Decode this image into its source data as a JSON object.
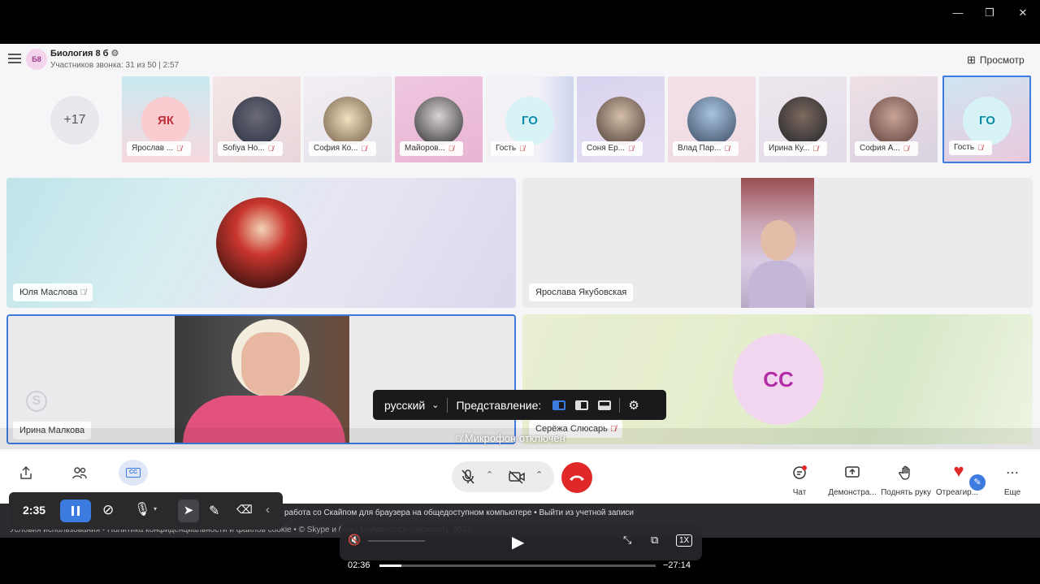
{
  "group": {
    "initials": "Б8",
    "title": "Биология 8 б",
    "subtitle": "Участников звонка: 31 из 50 | 2:57",
    "overflow": "+17",
    "preview_label": "Просмотр"
  },
  "thumbs": [
    {
      "name": "Ярослав ...",
      "initials": "ЯК"
    },
    {
      "name": "Sofiya Ho..."
    },
    {
      "name": "София Ко..."
    },
    {
      "name": "Майоров..."
    },
    {
      "name": "Гость",
      "initials": "ГО"
    },
    {
      "name": "Соня Ер..."
    },
    {
      "name": "Влад Пар..."
    },
    {
      "name": "Ирина Ку..."
    },
    {
      "name": "София А..."
    },
    {
      "name": "Гость",
      "initials": "ГО"
    }
  ],
  "tiles": [
    {
      "name": "Юля Маслова"
    },
    {
      "name": "Ярослава Якубовская"
    },
    {
      "name": "Ирина Малкова"
    },
    {
      "name": "Серёжа Слюсарь",
      "initials": "СС"
    }
  ],
  "caption_pill": {
    "language": "русский",
    "view_label": "Представление:"
  },
  "mic_status": "Микрофон отключен",
  "controls": {
    "chat": "Чат",
    "share": "Демонстра...",
    "raise_hand": "Поднять руку",
    "react": "Отреагир...",
    "more": "Еще"
  },
  "footer": {
    "line1": "работа со Скайпом для браузера на общедоступном компьютере  •  Выйти из учетной записи",
    "line2": "Условия использования  •  Политика конфиденциальности и файлов cookie  •  © Skype и (или) Майкрософт (Microsoft), 2023."
  },
  "drawbar": {
    "time": "2:35"
  },
  "player": {
    "elapsed": "02:36",
    "remaining": "−27:14",
    "speed": "1X",
    "progress": 0.08
  },
  "colors": {
    "accent": "#3c7be0",
    "hangup": "#e02828"
  }
}
